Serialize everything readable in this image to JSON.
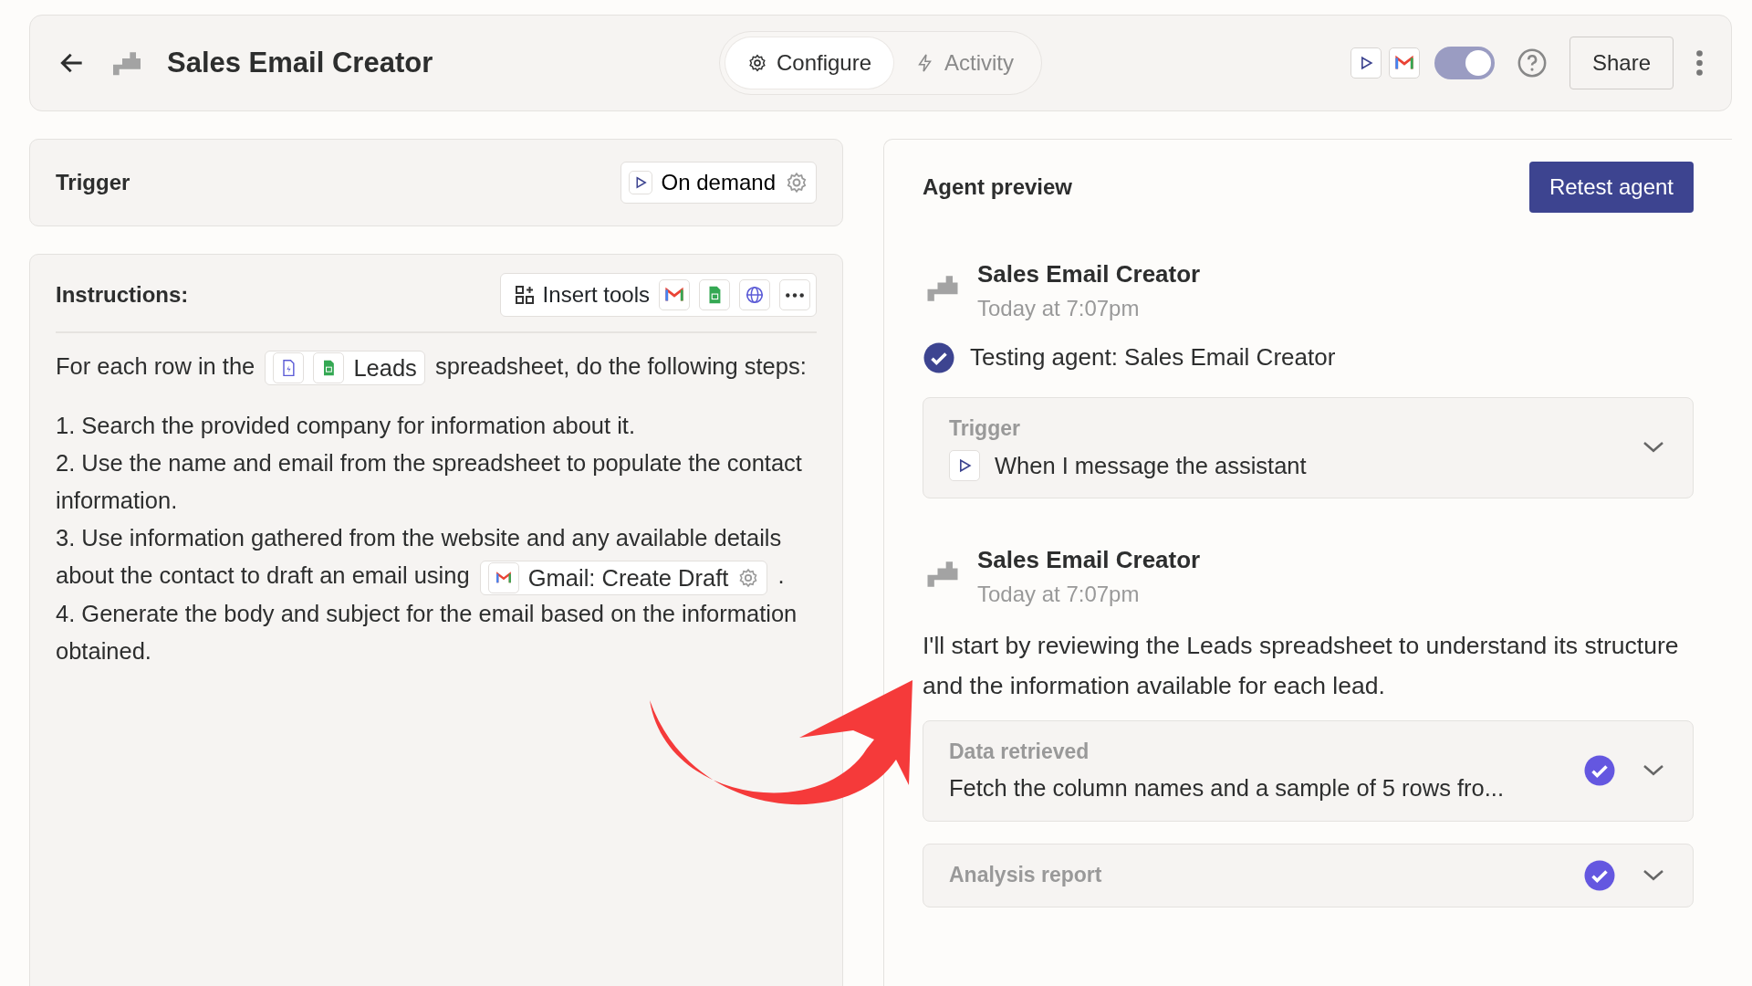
{
  "header": {
    "title": "Sales Email Creator",
    "tabs": [
      {
        "label": "Configure",
        "selected": true
      },
      {
        "label": "Activity",
        "selected": false
      }
    ],
    "toggle": {
      "on": true
    },
    "share": "Share"
  },
  "trigger": {
    "label": "Trigger",
    "value": "On demand"
  },
  "instructions": {
    "label": "Instructions:",
    "tools_button": "Insert tools",
    "paragraphs": [
      [
        {
          "kind": "text",
          "text": "For each row in the"
        },
        {
          "kind": "sheet_chip",
          "text": "Leads"
        },
        {
          "kind": "text",
          "text": "spreadsheet, do the following steps:"
        }
      ],
      [
        {
          "kind": "text",
          "text": "1. Search the provided company for information about it."
        }
      ],
      [
        {
          "kind": "text",
          "text": "2. Use the name and email from the spreadsheet to populate the contact information."
        }
      ],
      [
        {
          "kind": "text",
          "text": "3. Use information gathered from the website and any available details about the contact to draft an email using"
        },
        {
          "kind": "tool_chip",
          "text": "Gmail: Create Draft"
        },
        {
          "kind": "text",
          "text": "."
        }
      ],
      [
        {
          "kind": "text",
          "text": "4. Generate the body and subject for the email based on the information obtained."
        }
      ]
    ]
  },
  "preview": {
    "title": "Agent preview",
    "button": "Retest agent",
    "feed": [
      {
        "kind": "message",
        "name": "Sales Email Creator",
        "time": "Today at 7:07pm"
      },
      {
        "kind": "status",
        "text": "Testing agent: Sales Email Creator"
      },
      {
        "kind": "step",
        "label": "Trigger",
        "text": "When I message the assistant",
        "done": false,
        "expanded": false
      },
      {
        "kind": "message",
        "name": "Sales Email Creator",
        "time": "Today at 7:07pm"
      },
      {
        "kind": "reply",
        "text": "I'll start by reviewing the Leads spreadsheet to understand its structure and the information available for each lead."
      },
      {
        "kind": "step",
        "label": "Data retrieved",
        "text": "Fetch the column names and a sample of 5 rows fro...",
        "done": true,
        "expanded": false
      },
      {
        "kind": "step",
        "label": "Analysis report",
        "done": true,
        "expanded": false
      }
    ]
  }
}
